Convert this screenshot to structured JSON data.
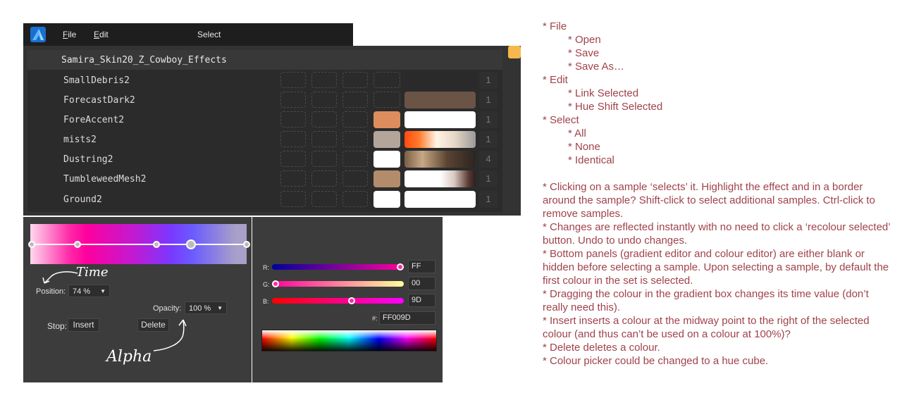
{
  "menubar": {
    "file_u": "F",
    "file_rest": "ile",
    "edit_u": "E",
    "edit_rest": "dit",
    "select": "Select"
  },
  "effects": {
    "title": "Samira_Skin20_Z_Cowboy_Effects",
    "tag_color": "#f7b84b",
    "rows": [
      {
        "name": "SmallDebris2",
        "count": "1"
      },
      {
        "name": "ForecastDark2",
        "count": "1"
      },
      {
        "name": "ForeAccent2",
        "count": "1"
      },
      {
        "name": "mists2",
        "count": "1"
      },
      {
        "name": "Dustring2",
        "count": "4"
      },
      {
        "name": "TumbleweedMesh2",
        "count": "1"
      },
      {
        "name": "Ground2",
        "count": "1"
      }
    ]
  },
  "gradient_editor": {
    "position_label": "Position:",
    "position_value": "74 %",
    "opacity_label": "Opacity:",
    "opacity_value": "100 %",
    "stop_label": "Stop:",
    "insert_label": "Insert",
    "delete_label": "Delete",
    "annotation_time": "Time",
    "annotation_alpha": "Alpha"
  },
  "colour_editor": {
    "r_label": "R:",
    "r_value": "FF",
    "g_label": "G:",
    "g_value": "00",
    "b_label": "B:",
    "b_value": "9D",
    "hex_label": "#:",
    "hex_value": "FF009D"
  },
  "notes": {
    "file": "* File",
    "open": "* Open",
    "save": "* Save",
    "save_as": "* Save As…",
    "edit": "* Edit",
    "link_selected": "* Link Selected",
    "hue_shift": "* Hue Shift Selected",
    "select": "* Select",
    "all": "* All",
    "none": "* None",
    "identical": "* Identical",
    "p1": "* Clicking on a sample ‘selects’ it. Highlight the effect and in a border around the sample? Shift-click to select additional samples. Ctrl-click to remove samples.",
    "p2": "* Changes are reflected instantly with no need to click a ‘recolour selected’ button. Undo to undo changes.",
    "p3": "* Bottom panels (gradient editor and colour editor) are either blank or hidden before selecting a sample. Upon selecting a sample, by default the first colour in the set is selected.",
    "p4": "* Dragging the colour in the gradient box changes its time value (don’t really need this).",
    "p5": "* Insert inserts a colour at the midway point to the right of the selected colour (and thus can’t be used on a colour at 100%)?",
    "p6": "* Delete deletes a colour.",
    "p7": "* Colour picker could be changed to a hue cube."
  }
}
